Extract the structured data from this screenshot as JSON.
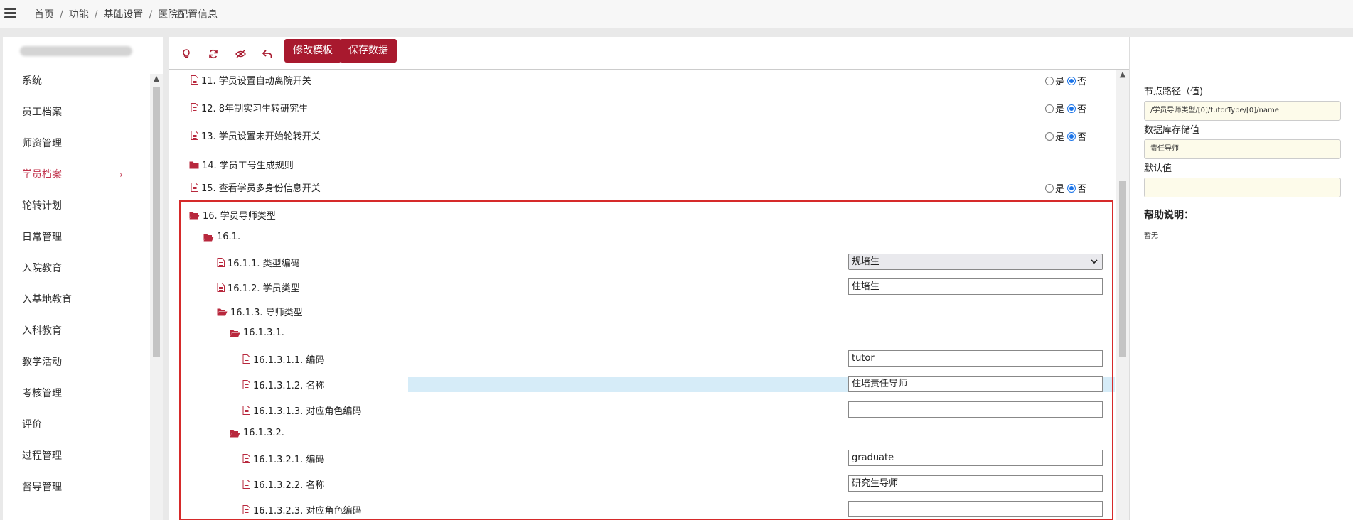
{
  "breadcrumb": {
    "items": [
      "首页",
      "功能",
      "基础设置",
      "医院配置信息"
    ]
  },
  "sidebar": {
    "items": [
      {
        "label": "系统"
      },
      {
        "label": "员工档案"
      },
      {
        "label": "师资管理"
      },
      {
        "label": "学员档案",
        "active": true
      },
      {
        "label": "轮转计划"
      },
      {
        "label": "日常管理"
      },
      {
        "label": "入院教育"
      },
      {
        "label": "入基地教育"
      },
      {
        "label": "入科教育"
      },
      {
        "label": "教学活动"
      },
      {
        "label": "考核管理"
      },
      {
        "label": "评价"
      },
      {
        "label": "过程管理"
      },
      {
        "label": "督导管理"
      }
    ]
  },
  "toolbar": {
    "icons": [
      "lightbulb-icon",
      "refresh-icon",
      "eye-slash-icon",
      "undo-icon"
    ],
    "modify_template_label": "修改模板",
    "save_data_label": "保存数据"
  },
  "radio_labels": {
    "yes": "是",
    "no": "否"
  },
  "tree": {
    "rows": [
      {
        "label": "11. 学员设置自动离院开关",
        "type": "file",
        "indent": 0,
        "radio": "否"
      },
      {
        "label": "12. 8年制实习生转研究生",
        "type": "file",
        "indent": 0,
        "radio": "否"
      },
      {
        "label": "13. 学员设置未开始轮转开关",
        "type": "file",
        "indent": 0,
        "radio": "否"
      },
      {
        "label": "14. 学员工号生成规则",
        "type": "folder-closed",
        "indent": 0
      },
      {
        "label": "15. 查看学员多身份信息开关",
        "type": "file",
        "indent": 0,
        "radio": "否"
      },
      {
        "label": "16. 学员导师类型",
        "type": "folder-open",
        "indent": 0
      },
      {
        "label": "16.1.",
        "type": "folder-open",
        "indent": 1
      },
      {
        "label": "16.1.1. 类型编码",
        "type": "file",
        "indent": 2,
        "select": "规培生"
      },
      {
        "label": "16.1.2. 学员类型",
        "type": "file",
        "indent": 2,
        "value": "住培生"
      },
      {
        "label": "16.1.3. 导师类型",
        "type": "folder-open",
        "indent": 2
      },
      {
        "label": "16.1.3.1.",
        "type": "folder-open",
        "indent": 3
      },
      {
        "label": "16.1.3.1.1. 编码",
        "type": "file",
        "indent": 4,
        "value": "tutor"
      },
      {
        "label": "16.1.3.1.2. 名称",
        "type": "file",
        "indent": 4,
        "value": "住培责任导师",
        "selected": true
      },
      {
        "label": "16.1.3.1.3. 对应角色编码",
        "type": "file",
        "indent": 4,
        "value": ""
      },
      {
        "label": "16.1.3.2.",
        "type": "folder-open",
        "indent": 3
      },
      {
        "label": "16.1.3.2.1. 编码",
        "type": "file",
        "indent": 4,
        "value": "graduate"
      },
      {
        "label": "16.1.3.2.2. 名称",
        "type": "file",
        "indent": 4,
        "value": "研究生导师"
      },
      {
        "label": "16.1.3.2.3. 对应角色编码",
        "type": "file",
        "indent": 4,
        "value": ""
      }
    ]
  },
  "right_panel": {
    "node_path_label": "节点路径（值)",
    "node_path_value": "/学员导师类型/[0]/tutorType/[0]/name",
    "db_value_label": "数据库存储值",
    "db_value": "责任导师",
    "default_label": "默认值",
    "default_value": "",
    "help_title": "帮助说明：",
    "help_text": "暂无"
  },
  "colors": {
    "accent": "#a8192e",
    "active_menu": "#c0304a",
    "highlight_box": "#d62a2a",
    "selected_row": "#d6ecf8"
  }
}
